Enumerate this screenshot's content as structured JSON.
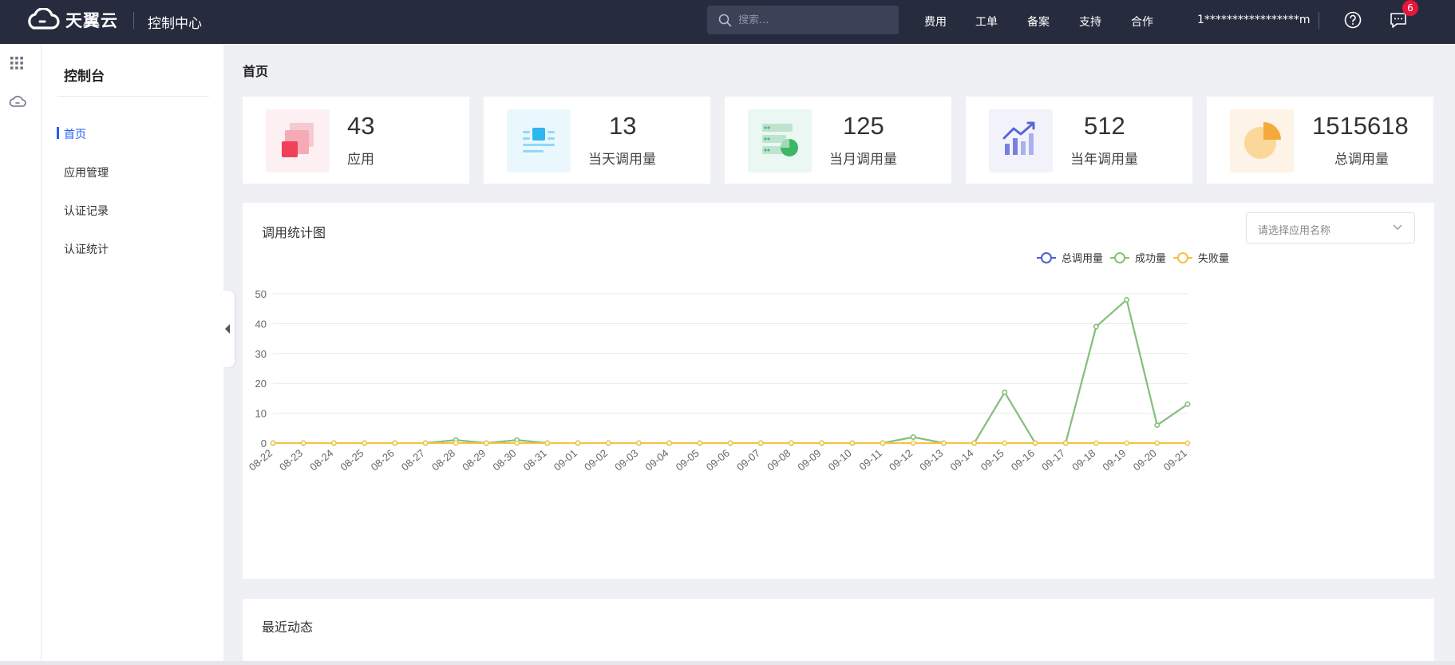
{
  "header": {
    "logo_text": "天翼云",
    "console_title": "控制中心",
    "search_placeholder": "搜索...",
    "nav": [
      {
        "label": "费用"
      },
      {
        "label": "工单"
      },
      {
        "label": "备案"
      },
      {
        "label": "支持"
      },
      {
        "label": "合作"
      }
    ],
    "user": "1*****************m",
    "message_count": "6",
    "icons": [
      "cloud-logo-icon",
      "search-icon",
      "help-icon",
      "message-icon"
    ]
  },
  "rail": {
    "icons": [
      "apps-grid-icon",
      "cloud-icon"
    ]
  },
  "sidebar": {
    "title": "控制台",
    "items": [
      {
        "label": "首页",
        "active": true
      },
      {
        "label": "应用管理"
      },
      {
        "label": "认证记录"
      },
      {
        "label": "认证统计"
      }
    ]
  },
  "main": {
    "page_title": "首页",
    "stats": [
      {
        "value": "43",
        "label": "应用",
        "icon": "apps-stack-icon",
        "icon_bg": "#fdf0f2"
      },
      {
        "value": "13",
        "label": "当天调用量",
        "icon": "list-doc-icon",
        "icon_bg": "#eaf8fd"
      },
      {
        "value": "125",
        "label": "当月调用量",
        "icon": "server-pie-icon",
        "icon_bg": "#eaf7f3"
      },
      {
        "value": "512",
        "label": "当年调用量",
        "icon": "bar-trend-icon",
        "icon_bg": "#f2f2fb"
      },
      {
        "value": "1515618",
        "label": "总调用量",
        "icon": "pie-chart-icon",
        "icon_bg": "#fdf3e7"
      }
    ],
    "chart_panel": {
      "title": "调用统计图",
      "select_placeholder": "请选择应用名称"
    },
    "recent_title": "最近动态"
  },
  "colors": {
    "header_bg": "#262b3e",
    "accent": "#2660f0",
    "series_total": "#4a63c8",
    "series_success": "#85c472",
    "series_fail": "#f5c342",
    "badge": "#e5173a"
  },
  "chart_data": {
    "type": "line",
    "x": [
      "08-22",
      "08-23",
      "08-24",
      "08-25",
      "08-26",
      "08-27",
      "08-28",
      "08-29",
      "08-30",
      "08-31",
      "09-01",
      "09-02",
      "09-03",
      "09-04",
      "09-05",
      "09-06",
      "09-07",
      "09-08",
      "09-09",
      "09-10",
      "09-11",
      "09-12",
      "09-13",
      "09-14",
      "09-15",
      "09-16",
      "09-17",
      "09-18",
      "09-19",
      "09-20",
      "09-21"
    ],
    "series": [
      {
        "name": "总调用量",
        "color": "#4a63c8",
        "values": [
          0,
          0,
          0,
          0,
          0,
          0,
          1,
          0,
          1,
          0,
          0,
          0,
          0,
          0,
          0,
          0,
          0,
          0,
          0,
          0,
          0,
          2,
          0,
          0,
          17,
          0,
          0,
          39,
          48,
          6,
          13
        ]
      },
      {
        "name": "成功量",
        "color": "#85c472",
        "values": [
          0,
          0,
          0,
          0,
          0,
          0,
          1,
          0,
          1,
          0,
          0,
          0,
          0,
          0,
          0,
          0,
          0,
          0,
          0,
          0,
          0,
          2,
          0,
          0,
          17,
          0,
          0,
          39,
          48,
          6,
          13
        ]
      },
      {
        "name": "失败量",
        "color": "#f5c342",
        "values": [
          0,
          0,
          0,
          0,
          0,
          0,
          0,
          0,
          0,
          0,
          0,
          0,
          0,
          0,
          0,
          0,
          0,
          0,
          0,
          0,
          0,
          0,
          0,
          0,
          0,
          0,
          0,
          0,
          0,
          0,
          0
        ]
      }
    ],
    "yticks": [
      0,
      10,
      20,
      30,
      40,
      50
    ],
    "ylim": [
      0,
      50
    ],
    "legend_position": "top-right",
    "grid": true
  }
}
